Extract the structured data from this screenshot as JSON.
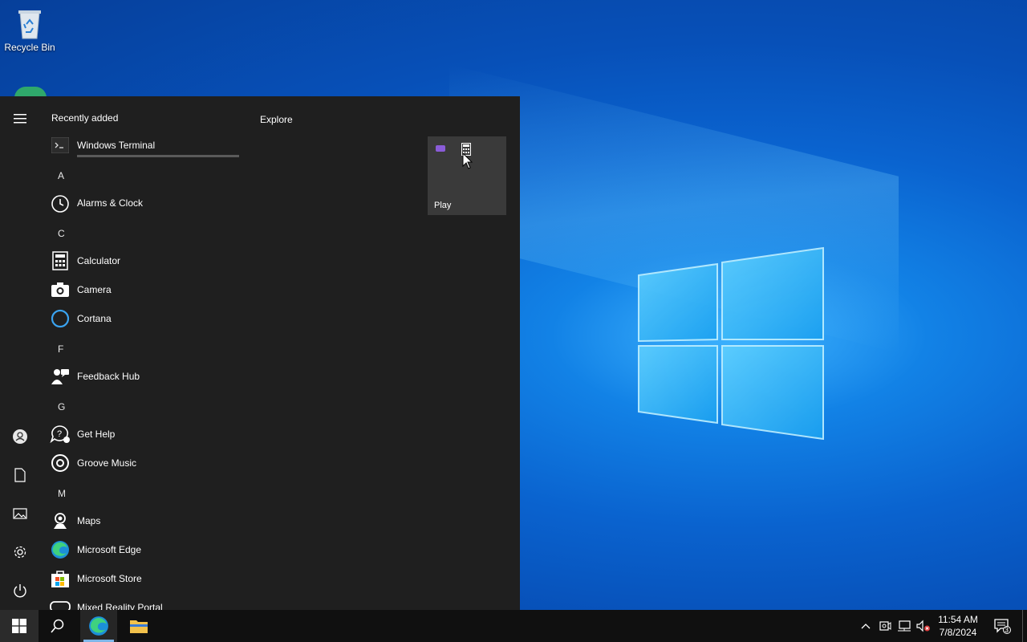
{
  "desktop": {
    "recycle_bin_label": "Recycle Bin"
  },
  "start_menu": {
    "section_title": "Recently added",
    "recent": [
      {
        "label": "Windows Terminal",
        "icon": "terminal-icon"
      }
    ],
    "groups": [
      {
        "letter": "A",
        "apps": [
          {
            "label": "Alarms & Clock",
            "icon": "alarm-clock-icon"
          }
        ]
      },
      {
        "letter": "C",
        "apps": [
          {
            "label": "Calculator",
            "icon": "calculator-icon"
          },
          {
            "label": "Camera",
            "icon": "camera-icon"
          },
          {
            "label": "Cortana",
            "icon": "cortana-icon"
          }
        ]
      },
      {
        "letter": "F",
        "apps": [
          {
            "label": "Feedback Hub",
            "icon": "feedback-hub-icon"
          }
        ]
      },
      {
        "letter": "G",
        "apps": [
          {
            "label": "Get Help",
            "icon": "get-help-icon"
          },
          {
            "label": "Groove Music",
            "icon": "groove-music-icon"
          }
        ]
      },
      {
        "letter": "M",
        "apps": [
          {
            "label": "Maps",
            "icon": "maps-icon"
          },
          {
            "label": "Microsoft Edge",
            "icon": "edge-icon"
          },
          {
            "label": "Microsoft Store",
            "icon": "store-icon"
          },
          {
            "label": "Mixed Reality Portal",
            "icon": "mixed-reality-icon"
          }
        ]
      }
    ],
    "tiles_title": "Explore",
    "tile": {
      "label": "Play"
    },
    "rail_icons": [
      "hamburger-menu-icon",
      "user-account-icon",
      "documents-icon",
      "pictures-icon",
      "settings-gear-icon",
      "power-icon"
    ]
  },
  "taskbar": {
    "time": "11:54 AM",
    "date": "7/8/2024",
    "notification_count": "3",
    "accent": "#7fb6e8"
  },
  "colors": {
    "start_bg": "#1f1f1f",
    "taskbar_bg": "#101010",
    "desktop_blue": "#0a63cf"
  }
}
